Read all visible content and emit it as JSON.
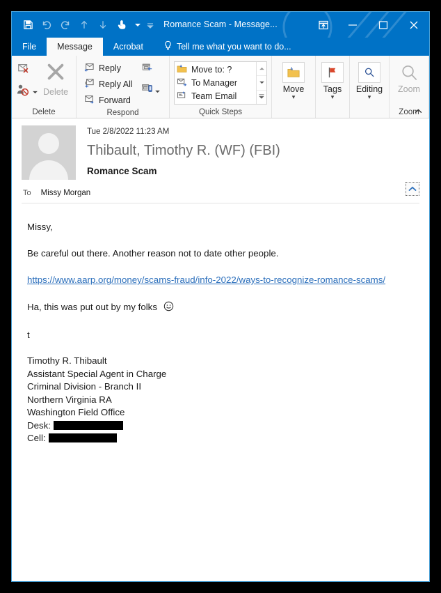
{
  "window": {
    "title": "Romance Scam - Message...",
    "quick_access": [
      {
        "name": "save-icon",
        "label": "Save"
      },
      {
        "name": "undo-icon",
        "label": "Undo"
      },
      {
        "name": "redo-icon",
        "label": "Redo"
      },
      {
        "name": "previous-item-icon",
        "label": "Previous Item"
      },
      {
        "name": "next-item-icon",
        "label": "Next Item"
      },
      {
        "name": "touch-mouse-mode-icon",
        "label": "Touch/Mouse Mode"
      },
      {
        "name": "touch-mode-dropdown-icon",
        "label": "Touch Mode Options"
      },
      {
        "name": "customize-quick-access-toolbar-icon",
        "label": "Customize Quick Access Toolbar"
      }
    ],
    "controls": [
      {
        "name": "ribbon-display-options-button",
        "label": "Ribbon Display Options"
      },
      {
        "name": "minimize-button",
        "label": "Minimize"
      },
      {
        "name": "maximize-button",
        "label": "Maximize"
      },
      {
        "name": "close-button",
        "label": "Close"
      }
    ]
  },
  "tabs": [
    {
      "label": "File",
      "active": false
    },
    {
      "label": "Message",
      "active": true
    },
    {
      "label": "Acrobat",
      "active": false
    }
  ],
  "tell_me": {
    "placeholder": "Tell me what you want to do...",
    "icon": "lightbulb-icon"
  },
  "ribbon": {
    "groups": [
      {
        "name": "delete",
        "label": "Delete",
        "items": [
          {
            "label": "Ignore",
            "icon": "ignore-icon"
          },
          {
            "label": "Junk",
            "icon": "junk-icon"
          },
          {
            "label": "Delete",
            "icon": "delete-x-icon",
            "disabled": true
          }
        ]
      },
      {
        "name": "respond",
        "label": "Respond",
        "items": [
          {
            "label": "Reply",
            "icon": "reply-icon"
          },
          {
            "label": "Reply All",
            "icon": "reply-all-icon"
          },
          {
            "label": "Forward",
            "icon": "forward-icon"
          },
          {
            "label": "Meeting",
            "icon": "meeting-icon"
          },
          {
            "label": "More",
            "icon": "more-respond-icon"
          }
        ]
      },
      {
        "name": "quick-steps",
        "label": "Quick Steps",
        "items": [
          {
            "label": "Move to: ?",
            "icon": "move-to-folder-icon"
          },
          {
            "label": "To Manager",
            "icon": "to-manager-icon"
          },
          {
            "label": "Team Email",
            "icon": "team-email-icon"
          }
        ],
        "scroll": [
          {
            "name": "quick-steps-scroll-up-button",
            "label": "Scroll Up"
          },
          {
            "name": "quick-steps-scroll-down-button",
            "label": "Scroll Down"
          },
          {
            "name": "quick-steps-more-button",
            "label": "More"
          }
        ],
        "dialog_launcher": "Quick Steps Dialog Box Launcher"
      },
      {
        "name": "move",
        "label": "",
        "items": [
          {
            "label": "Move",
            "icon": "move-folder-icon"
          }
        ]
      },
      {
        "name": "tags",
        "label": "",
        "items": [
          {
            "label": "Tags",
            "icon": "flag-icon"
          }
        ]
      },
      {
        "name": "editing",
        "label": "",
        "items": [
          {
            "label": "Editing",
            "icon": "editing-magnifier-icon"
          }
        ]
      },
      {
        "name": "zoom",
        "label": "Zoom",
        "items": [
          {
            "label": "Zoom",
            "icon": "zoom-magnifier-icon",
            "disabled": true
          }
        ]
      }
    ],
    "collapse_label": "Collapse the Ribbon"
  },
  "message": {
    "date": "Tue 2/8/2022 11:23 AM",
    "sender": "Thibault, Timothy R. (WF) (FBI)",
    "subject": "Romance Scam",
    "to_label": "To",
    "to_value": "Missy Morgan",
    "expand_label": "Expand",
    "body": {
      "greeting": "Missy,",
      "paragraph": "Be careful out there. Another reason not to date other people.",
      "link": "https://www.aarp.org/money/scams-fraud/info-2022/ways-to-recognize-romance-scams/",
      "note": "Ha, this was put out by my folks",
      "emoji": "smiley-face-icon",
      "signoff": "t",
      "signature": [
        "Timothy R. Thibault",
        "Assistant Special Agent in Charge",
        "Criminal Division - Branch II",
        "Northern Virginia RA",
        "Washington Field Office"
      ],
      "contacts": [
        {
          "label": "Desk:",
          "value": "",
          "redacted": true
        },
        {
          "label": "Cell:",
          "value": "",
          "redacted": true
        }
      ]
    }
  },
  "colors": {
    "titlebar": "#0072c6",
    "link": "#2a6ebb",
    "redaction": "#000000",
    "sender_text": "#6b6b6b"
  }
}
